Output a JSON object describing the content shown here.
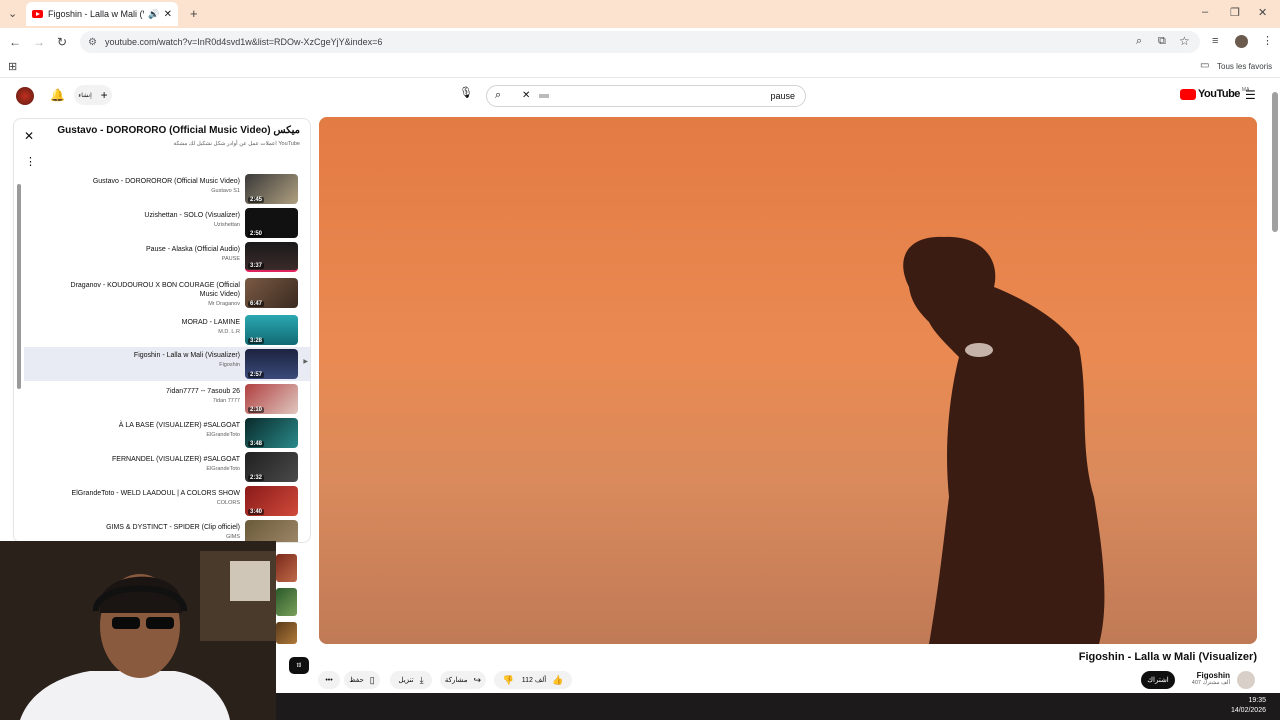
{
  "browser": {
    "tab_title": "Figoshin - Lalla w Mali (Visu",
    "url": "youtube.com/watch?v=InR0d4svd1w&list=RDOw-XzCgeYjY&index=6",
    "bookmarks_label": "Tous les favoris"
  },
  "youtube": {
    "logo_text": "YouTube",
    "logo_sup": "MA",
    "create_label": "إنشاء",
    "search_value": "pause"
  },
  "playlist": {
    "title": "Gustavo - DORORORO (Official Music Video) ميكس",
    "subtitle": "اعملات عمل عن أوادر شكل تشكيل لك مشكة YouTube",
    "items": [
      {
        "title": "Gustavo - DOROROROR (Official Music Video)",
        "channel": "Gustavo S1",
        "duration": "2:45",
        "active": false
      },
      {
        "title": "Uzishettan - SOLO (Visualizer)",
        "channel": "Uzishettan",
        "duration": "2:50",
        "active": false
      },
      {
        "title": "Pause - Alaska (Official Audio)",
        "channel": "PAUSE",
        "duration": "3:37",
        "active": false
      },
      {
        "title": "Draganov - KOUDOUROU X BON COURAGE (Official Music Video)",
        "channel": "Mr Draganov",
        "duration": "6:47",
        "active": false
      },
      {
        "title": "MORAD - LAMINE",
        "channel": "M.D. L.R",
        "duration": "3:28",
        "active": false
      },
      {
        "title": "Figoshin - Lalla w Mali (Visualizer)",
        "channel": "Figoshin",
        "duration": "2:57",
        "active": true
      },
      {
        "title": "7idan7777 -- 7asoub 26",
        "channel": "7idan 7777",
        "duration": "2:10",
        "active": false
      },
      {
        "title": "À LA BASE (VISUALIZER) #SALGOAT",
        "channel": "ElGrandeToto",
        "duration": "3:48",
        "active": false
      },
      {
        "title": "FERNANDEL (VISUALIZER) #SALGOAT",
        "channel": "ElGrandeToto",
        "duration": "2:32",
        "active": false
      },
      {
        "title": "ElGrandeToto - WELD LAADOUL | A COLORS SHOW",
        "channel": "COLORS",
        "duration": "3:40",
        "active": false
      },
      {
        "title": "GIMS & DYSTINCT - SPIDER (Clip officiel)",
        "channel": "GIMS",
        "duration": "",
        "active": false
      }
    ]
  },
  "video": {
    "title": "Figoshin - Lalla w Mali (Visualizer)",
    "channel": "Figoshin",
    "subscribers": "407 ألف مشترك",
    "subscribe_label": "اشتراك",
    "likes": "112 ألف",
    "share_label": "مشاركة",
    "download_label": "تنزيل",
    "save_label": "حفظ",
    "chip_label": "ttl"
  },
  "taskbar": {
    "time": "19:35",
    "date": "14/02/2026"
  },
  "colors": {
    "youtube_red": "#ff0000",
    "tabbar_bg": "#fbe3cf",
    "active_item_bg": "#e8ebf3"
  }
}
